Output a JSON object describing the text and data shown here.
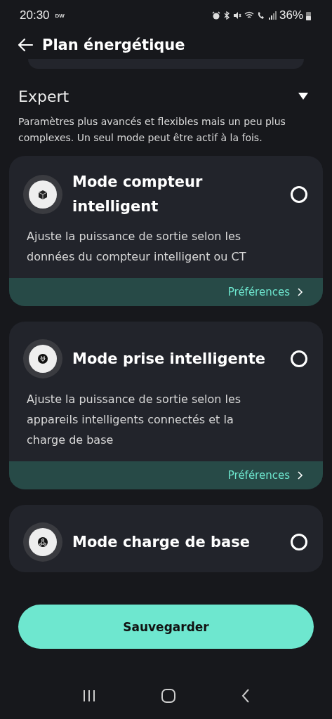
{
  "status_bar": {
    "time": "20:30",
    "carrier": "DW",
    "battery": "36%"
  },
  "header": {
    "title": "Plan énergétique"
  },
  "section": {
    "title": "Expert",
    "expanded": true,
    "description": "Paramètres plus avancés et flexibles mais un peu plus complexes. Un seul mode peut être actif à la fois."
  },
  "modes": [
    {
      "kind": "cube",
      "title": "Mode compteur intelligent",
      "description": "Ajuste la puissance de sortie selon les données du compteur intelligent ou CT",
      "selected": false,
      "link": "Préférences"
    },
    {
      "kind": "plug",
      "title": "Mode prise intelligente",
      "description": "Ajuste la puissance de sortie selon les appareils intelligents connectés et la charge de base",
      "selected": false,
      "link": "Préférences"
    },
    {
      "kind": "network",
      "title": "Mode charge de base",
      "selected": false
    }
  ],
  "save_button": "Sauvegarder"
}
